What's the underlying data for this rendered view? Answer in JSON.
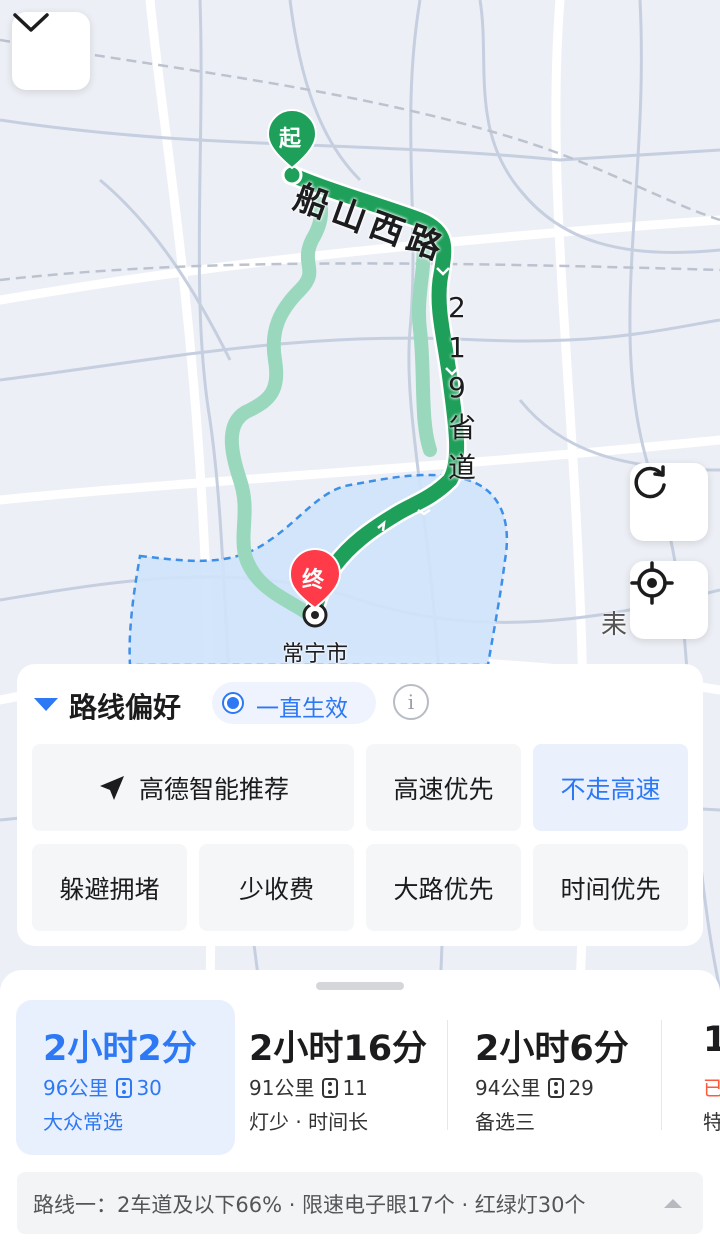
{
  "map": {
    "start_marker": "起",
    "end_marker": "终",
    "road_label_1": "船山西路",
    "road_label_2": "219省道",
    "city_label": "常宁市",
    "edge_label": "耒",
    "colors": {
      "route_main": "#1fa05a",
      "route_alt": "#9ad8bd",
      "start": "#1fa05a",
      "end": "#ff3b4a",
      "district_fill": "#cfe3fb",
      "district_border": "#3d8fe8"
    }
  },
  "controls": {
    "collapse_icon": "chevron-down-icon",
    "refresh_icon": "refresh-icon",
    "locate_icon": "locate-icon"
  },
  "preferences": {
    "title": "路线偏好",
    "always_label": "一直生效",
    "info_glyph": "i",
    "options": {
      "smart": "高德智能推荐",
      "highway": "高速优先",
      "no_highway": "不走高速",
      "avoid": "躲避拥堵",
      "less_toll": "少收费",
      "main_road": "大路优先",
      "time": "时间优先"
    },
    "selected": "不走高速"
  },
  "routes": [
    {
      "time": "2小时2分",
      "distance": "96公里",
      "lights": "30",
      "tag": "大众常选",
      "selected": true
    },
    {
      "time": "2小时16分",
      "distance": "91公里",
      "lights": "11",
      "tag": "灯少 · 时间长",
      "selected": false
    },
    {
      "time": "2小时6分",
      "distance": "94公里",
      "lights": "29",
      "tag": "备选三",
      "selected": false
    },
    {
      "time": "1",
      "distance": "已",
      "lights": "",
      "tag": "特",
      "selected": false
    }
  ],
  "summary": "路线一：2车道及以下66% · 限速电子眼17个 · 红绿灯30个"
}
